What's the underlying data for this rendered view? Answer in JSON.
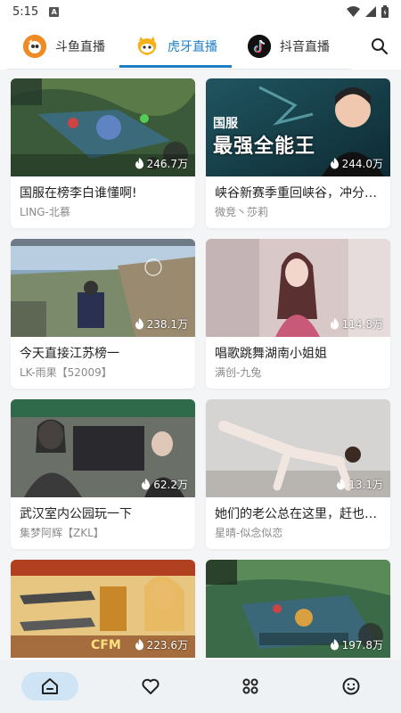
{
  "status_bar": {
    "time": "5:15",
    "notification_letter": "A"
  },
  "tabs": [
    {
      "label": "斗鱼直播",
      "icon": "douyu-logo-icon",
      "active": false
    },
    {
      "label": "虎牙直播",
      "icon": "huya-logo-icon",
      "active": true
    },
    {
      "label": "抖音直播",
      "icon": "douyin-logo-icon",
      "active": false
    }
  ],
  "streams": [
    {
      "title": "国服在榜李白谁懂啊!",
      "author": "LING-北慕",
      "viewers": "246.7万"
    },
    {
      "title": "峡谷新赛季重回峡谷，冲分…",
      "author": "微竞丶莎莉",
      "viewers": "244.0万",
      "thumb_text": "最强全能王",
      "thumb_tag": "国服"
    },
    {
      "title": "今天直接江苏榜一",
      "author": "LK-雨果【52009】",
      "viewers": "238.1万"
    },
    {
      "title": "唱歌跳舞湖南小姐姐",
      "author": "满创-九兔",
      "viewers": "114.8万"
    },
    {
      "title": "武汉室内公园玩一下",
      "author": "集梦阿辉【ZKL】",
      "viewers": "62.2万"
    },
    {
      "title": "她们的老公总在这里，赶也…",
      "author": "星晴-似念似恋",
      "viewers": "13.1万"
    },
    {
      "title": "",
      "author": "",
      "viewers": "223.6万",
      "thumb_text": "CFM"
    },
    {
      "title": "",
      "author": "",
      "viewers": "197.8万"
    }
  ],
  "bottom_nav": [
    {
      "name": "home",
      "icon": "home-icon",
      "active": true
    },
    {
      "name": "favorites",
      "icon": "heart-icon",
      "active": false
    },
    {
      "name": "categories",
      "icon": "grid-icon",
      "active": false
    },
    {
      "name": "profile",
      "icon": "smiley-icon",
      "active": false
    }
  ],
  "colors": {
    "accent": "#1e7fc4",
    "nav_active_bg": "#cfe4f4"
  }
}
